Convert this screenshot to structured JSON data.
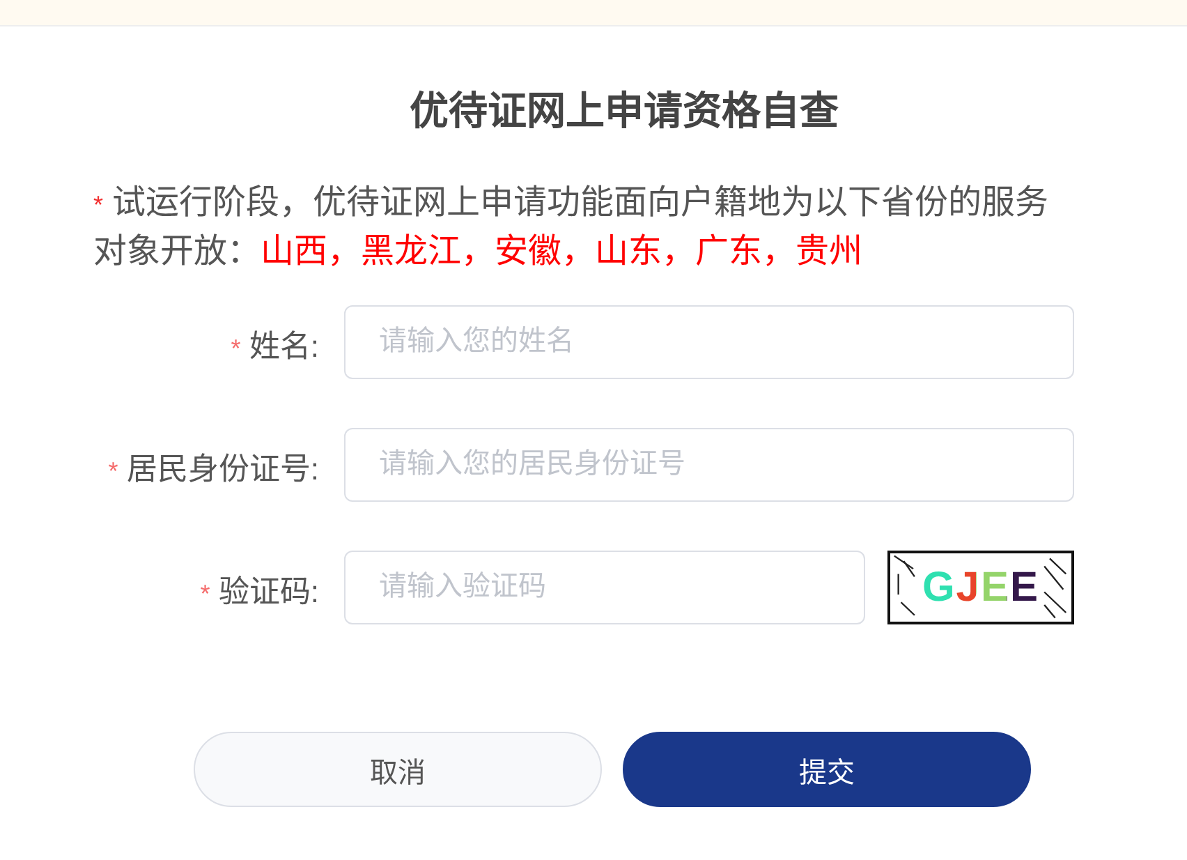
{
  "title": "优待证网上申请资格自查",
  "notice": {
    "mark": "*",
    "text": "试运行阶段，优待证网上申请功能面向户籍地为以下省份的服务对象开放：",
    "highlight": "山西，黑龙江，安徽，山东，广东，贵州"
  },
  "fields": [
    {
      "kind": "text",
      "required_mark": "*",
      "label": "姓名:",
      "placeholder": "请输入您的姓名"
    },
    {
      "kind": "text",
      "required_mark": "*",
      "label": "居民身份证号:",
      "placeholder": "请输入您的居民身份证号"
    },
    {
      "kind": "captcha",
      "required_mark": "*",
      "label": "验证码:",
      "placeholder": "请输入验证码",
      "captcha_text": "GJEE"
    }
  ],
  "buttons": [
    {
      "kind": "secondary",
      "label": "取消"
    },
    {
      "kind": "primary",
      "label": "提交"
    }
  ]
}
